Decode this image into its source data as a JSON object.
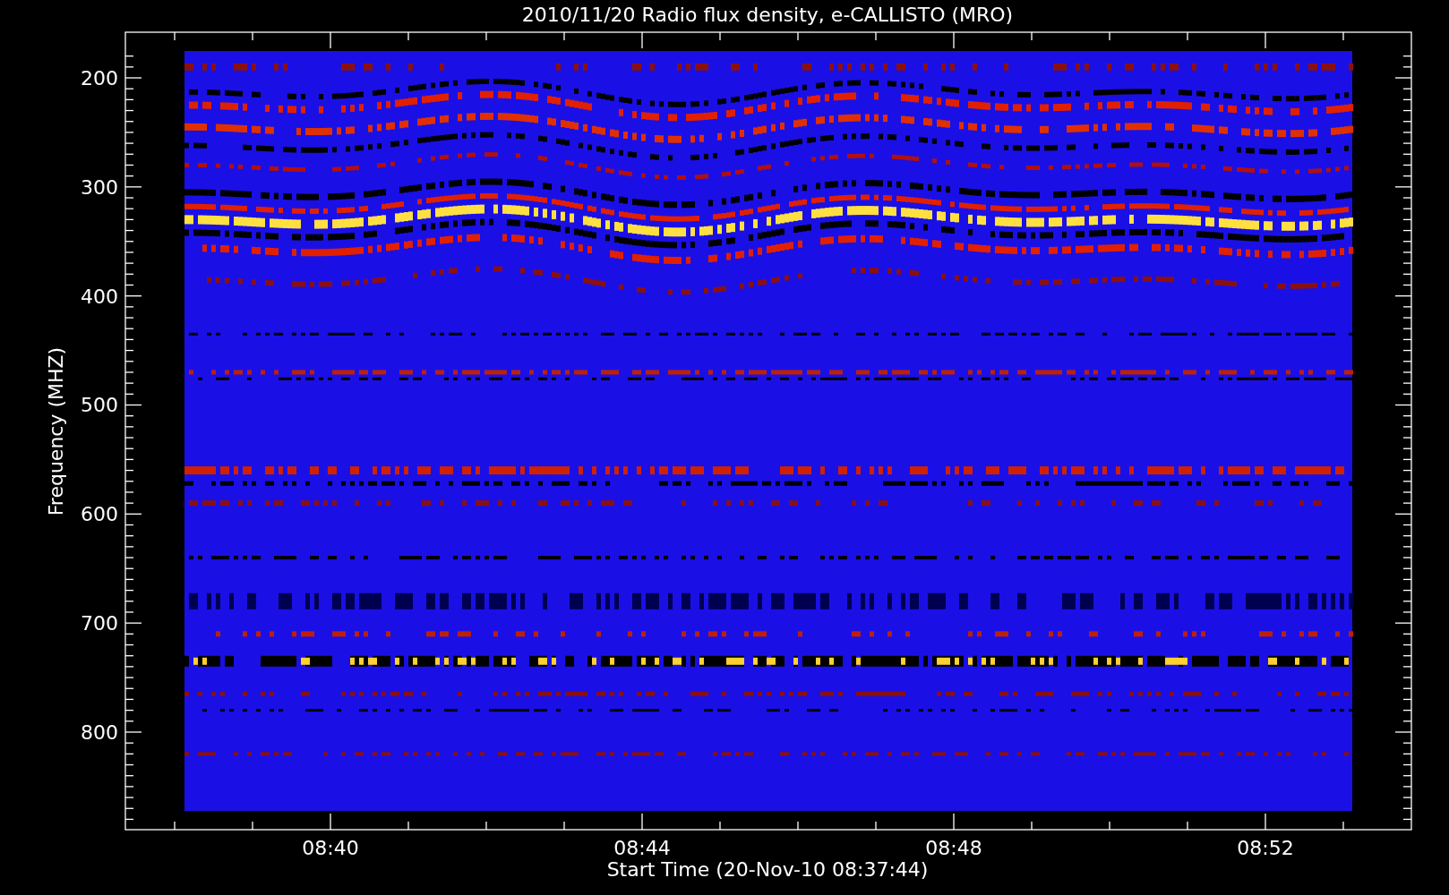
{
  "chart": {
    "title": "2010/11/20  Radio flux density, e-CALLISTO (MRO)",
    "xlabel": "Start Time (20-Nov-10 08:37:44)",
    "ylabel": "Frequency (MHZ)",
    "xticks": [
      "08:40",
      "08:44",
      "08:48",
      "08:52"
    ],
    "yticks": [
      "200",
      "300",
      "400",
      "500",
      "600",
      "700",
      "800"
    ]
  }
}
